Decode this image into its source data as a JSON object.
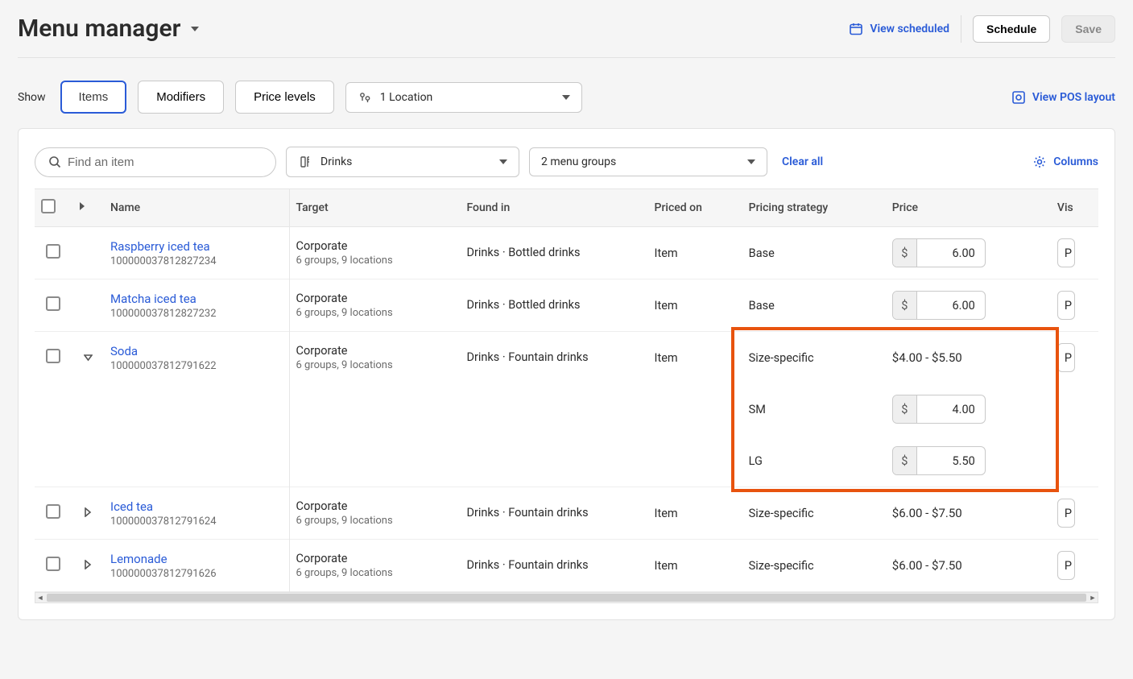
{
  "header": {
    "title": "Menu manager",
    "view_scheduled_label": "View scheduled",
    "schedule_label": "Schedule",
    "save_label": "Save"
  },
  "filters": {
    "show_label": "Show",
    "tabs": {
      "items": "Items",
      "modifiers": "Modifiers",
      "price_levels": "Price levels"
    },
    "location_label": "1 Location",
    "view_pos_label": "View POS layout"
  },
  "card": {
    "search_placeholder": "Find an item",
    "category_label": "Drinks",
    "groups_label": "2 menu groups",
    "clear_label": "Clear all",
    "columns_label": "Columns"
  },
  "table": {
    "headers": {
      "name": "Name",
      "target": "Target",
      "found_in": "Found in",
      "priced_on": "Priced on",
      "pricing_strategy": "Pricing strategy",
      "price": "Price",
      "visible": "Vis"
    },
    "rows": [
      {
        "name": "Raspberry iced tea",
        "id": "100000037812827234",
        "target": "Corporate",
        "target_meta": "6 groups, 9 locations",
        "found_in": "Drinks · Bottled drinks",
        "priced_on": "Item",
        "strategy": "Base",
        "price_type": "input",
        "price": "6.00",
        "expand": "none",
        "vis": "P"
      },
      {
        "name": "Matcha iced tea",
        "id": "100000037812827232",
        "target": "Corporate",
        "target_meta": "6 groups, 9 locations",
        "found_in": "Drinks · Bottled drinks",
        "priced_on": "Item",
        "strategy": "Base",
        "price_type": "input",
        "price": "6.00",
        "expand": "none",
        "vis": "P"
      },
      {
        "name": "Soda",
        "id": "100000037812791622",
        "target": "Corporate",
        "target_meta": "6 groups, 9 locations",
        "found_in": "Drinks · Fountain drinks",
        "priced_on": "Item",
        "strategy": "Size-specific",
        "price_type": "range",
        "price": "$4.00 - $5.50",
        "expand": "open",
        "vis": "P",
        "sizes": [
          {
            "label": "SM",
            "price": "4.00"
          },
          {
            "label": "LG",
            "price": "5.50"
          }
        ]
      },
      {
        "name": "Iced tea",
        "id": "100000037812791624",
        "target": "Corporate",
        "target_meta": "6 groups, 9 locations",
        "found_in": "Drinks · Fountain drinks",
        "priced_on": "Item",
        "strategy": "Size-specific",
        "price_type": "range",
        "price": "$6.00 - $7.50",
        "expand": "closed",
        "vis": "P"
      },
      {
        "name": "Lemonade",
        "id": "100000037812791626",
        "target": "Corporate",
        "target_meta": "6 groups, 9 locations",
        "found_in": "Drinks · Fountain drinks",
        "priced_on": "Item",
        "strategy": "Size-specific",
        "price_type": "range",
        "price": "$6.00 - $7.50",
        "expand": "closed",
        "vis": "P"
      }
    ]
  }
}
